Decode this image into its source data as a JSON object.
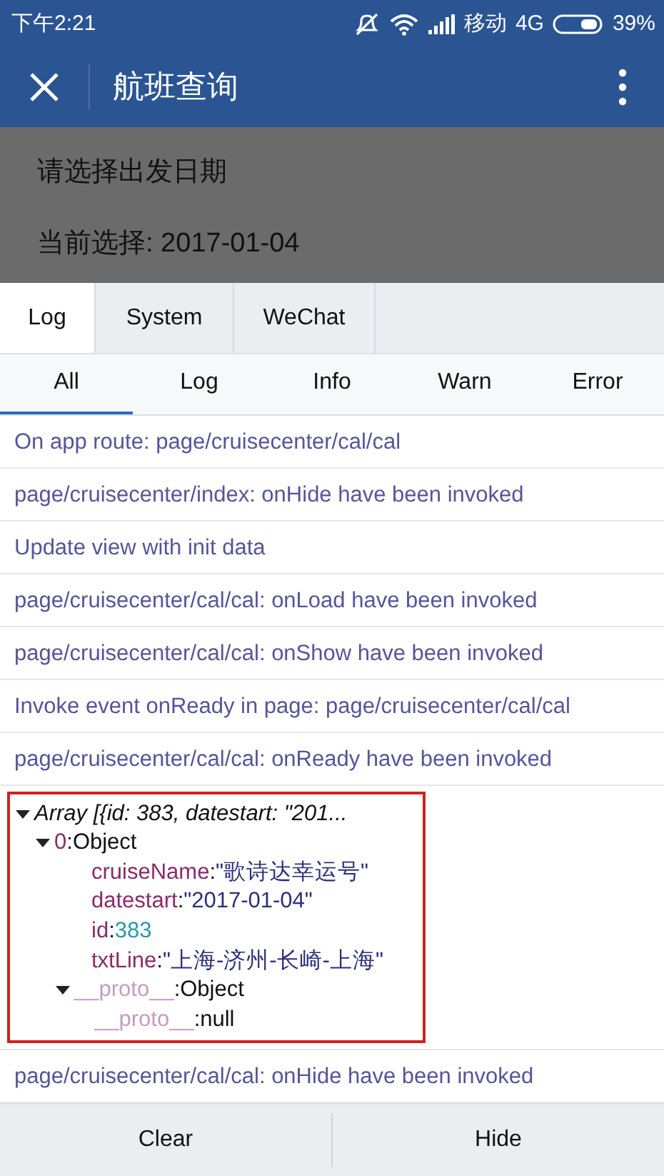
{
  "status_bar": {
    "time": "下午2:21",
    "carrier": "移动",
    "network": "4G",
    "battery": "39%"
  },
  "nav_bar": {
    "title": "航班查询"
  },
  "page": {
    "heading": "请选择出发日期",
    "current": "当前选择: 2017-01-04"
  },
  "tabs": [
    {
      "label": "Log",
      "selected": true
    },
    {
      "label": "System",
      "selected": false
    },
    {
      "label": "WeChat",
      "selected": false
    }
  ],
  "filters": [
    {
      "label": "All",
      "selected": true
    },
    {
      "label": "Log",
      "selected": false
    },
    {
      "label": "Info",
      "selected": false
    },
    {
      "label": "Warn",
      "selected": false
    },
    {
      "label": "Error",
      "selected": false
    }
  ],
  "log_before": [
    "On app route: page/cruisecenter/cal/cal",
    "page/cruisecenter/index: onHide have been invoked",
    "Update view with init data",
    "page/cruisecenter/cal/cal: onLoad have been invoked",
    "page/cruisecenter/cal/cal: onShow have been invoked",
    "Invoke event onReady in page: page/cruisecenter/cal/cal",
    "page/cruisecenter/cal/cal: onReady have been invoked"
  ],
  "object_tree": [
    {
      "kind": "summary",
      "value": "Array [{id: 383, datestart: \"201...",
      "expanded": true,
      "children": [
        {
          "kind": "index",
          "key": "0",
          "sep": ":",
          "value": "Object",
          "expanded": true,
          "children": [
            {
              "kind": "string",
              "key": "cruiseName",
              "sep": ":",
              "value": "\"歌诗达幸运号\""
            },
            {
              "kind": "string",
              "key": "datestart",
              "sep": ":",
              "value": "\"2017-01-04\""
            },
            {
              "kind": "number",
              "key": "id",
              "sep": ":",
              "value": "383"
            },
            {
              "kind": "string",
              "key": "txtLine",
              "sep": ":",
              "value": "\"上海-济州-长崎-上海\""
            },
            {
              "kind": "proto",
              "key": "__proto__",
              "sep": ":",
              "value": "Object",
              "expanded": true,
              "children": [
                {
                  "kind": "proto",
                  "key": "__proto__",
                  "sep": ":",
                  "value": "null"
                }
              ]
            }
          ]
        }
      ]
    }
  ],
  "log_after": [
    "page/cruisecenter/cal/cal: onHide have been invoked"
  ],
  "bottom_buttons": [
    "Clear",
    "Hide"
  ]
}
